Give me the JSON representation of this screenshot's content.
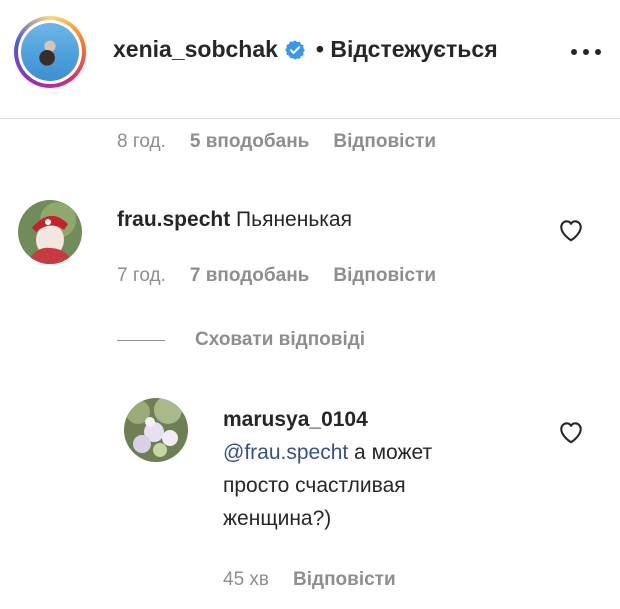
{
  "post": {
    "username": "xenia_sobchak",
    "follow_status": "• Відстежується"
  },
  "top_meta": {
    "time": "8 год.",
    "likes": "5 вподобань",
    "reply": "Відповісти"
  },
  "comment": {
    "username": "frau.specht",
    "text": "Пьяненькая",
    "time": "7 год.",
    "likes": "7 вподобань",
    "reply": "Відповісти"
  },
  "hide_replies_label": "Сховати відповіді",
  "reply_comment": {
    "username": "marusya_0104",
    "mention": "@frau.specht",
    "text_line1": " а может",
    "text_line2": "просто счастливая",
    "text_line3": "женщина?)",
    "time": "45 хв",
    "reply": "Відповісти"
  },
  "icons": {
    "verified": "verified-badge-icon",
    "more": "more-options-icon",
    "like": "heart-icon"
  },
  "colors": {
    "text": "#262626",
    "muted": "#8e8e8e",
    "verified": "#3897f0",
    "mention": "#385185"
  }
}
